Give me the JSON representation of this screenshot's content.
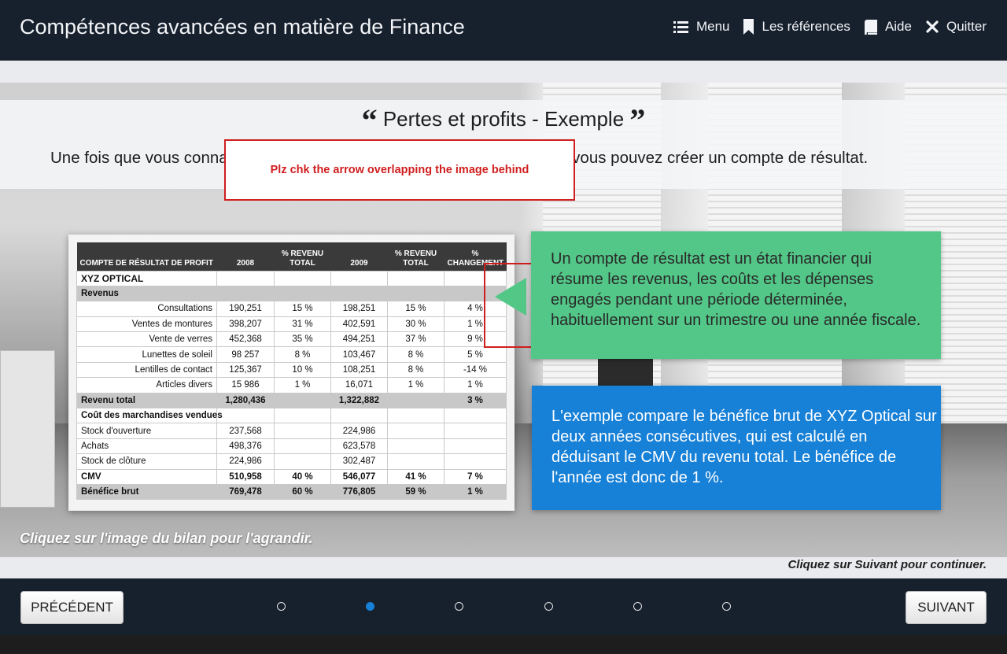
{
  "app": {
    "title": "Compétences avancées en matière de Finance"
  },
  "nav": {
    "menu": "Menu",
    "references": "Les références",
    "help": "Aide",
    "quit": "Quitter"
  },
  "slide": {
    "title": "Pertes et profits - Exemple",
    "intro": "Une fois que vous connaissez vos revenus, votre CMV et vos dépenses, vous pouvez créer un compte de résultat.",
    "review_note": "Plz chk the arrow overlapping the image behind",
    "green_text": "Un compte de résultat est un état financier qui résume les revenus, les coûts et les dépenses engagés pendant une période déterminée, habituellement sur un trimestre ou une année fiscale.",
    "blue_text": "L'exemple compare le bénéfice brut de XYZ Optical sur deux années consécutives, qui est calculé en déduisant le CMV du revenu total. Le bénéfice de l'année est donc de 1 %.",
    "hint_image": "Cliquez sur l'image du bilan pour l'agrandir.",
    "hint_next": "Cliquez sur Suivant pour continuer."
  },
  "statement": {
    "headers": [
      "COMPTE DE RÉSULTAT DE PROFIT",
      "2008",
      "% REVENU TOTAL",
      "2009",
      "% REVENU TOTAL",
      "% CHANGEMENT"
    ],
    "company": "XYZ OPTICAL",
    "revenue_section": "Revenus",
    "revenue_rows": [
      [
        "Consultations",
        "190,251",
        "15 %",
        "198,251",
        "15 %",
        "4 %"
      ],
      [
        "Ventes de montures",
        "398,207",
        "31 %",
        "402,591",
        "30 %",
        "1 %"
      ],
      [
        "Vente de verres",
        "452,368",
        "35 %",
        "494,251",
        "37 %",
        "9 %"
      ],
      [
        "Lunettes de soleil",
        "98 257",
        "8 %",
        "103,467",
        "8 %",
        "5 %"
      ],
      [
        "Lentilles de contact",
        "125,367",
        "10 %",
        "108,251",
        "8 %",
        "-14 %"
      ],
      [
        "Articles divers",
        "15 986",
        "1 %",
        "16,071",
        "1 %",
        "1 %"
      ]
    ],
    "total_revenue": [
      "Revenu total",
      "1,280,436",
      "",
      "1,322,882",
      "",
      "3 %"
    ],
    "cogs_section": "Coût des marchandises vendues",
    "cogs_rows": [
      [
        "Stock d'ouverture",
        "237,568",
        "",
        "224,986",
        "",
        ""
      ],
      [
        "Achats",
        "498,376",
        "",
        "623,578",
        "",
        ""
      ],
      [
        "Stock de clôture",
        "224,986",
        "",
        "302,487",
        "",
        ""
      ]
    ],
    "cmv": [
      "CMV",
      "510,958",
      "40 %",
      "546,077",
      "41 %",
      "7 %"
    ],
    "gross_profit": [
      "Bénéfice brut",
      "769,478",
      "60 %",
      "776,805",
      "59 %",
      "1 %"
    ]
  },
  "footer": {
    "prev": "PRÉCÉDENT",
    "next": "SUIVANT",
    "page_count": 6,
    "active_page": 2
  },
  "colors": {
    "green_card": "#52c787",
    "blue_card": "#1780d7",
    "top_bar": "#17202d",
    "note_border": "#d01e1e"
  }
}
